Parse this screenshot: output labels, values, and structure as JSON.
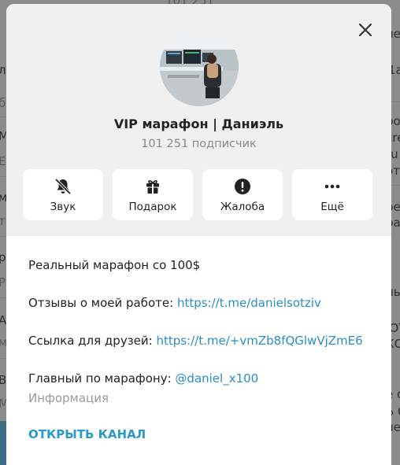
{
  "background": {
    "left_fragments": [
      "л",
      "б",
      "М",
      "Е",
      "м",
      "т",
      "р",
      "Р",
      "А",
      "м",
      "В",
      "М"
    ],
    "right_fragments": [
      "ле",
      "1а",
      "ро д",
      "cre",
      "ru",
      "от",
      "ре",
      "ра -",
      "ны",
      "ЮТ",
      "КО",
      "е о",
      "Ь О",
      "ле"
    ],
    "top_fragment": "101 251"
  },
  "dialog": {
    "channel_name": "VIP марафон | Даниэль",
    "subscribers": "101 251 подписчик",
    "actions": [
      {
        "label": "Звук",
        "icon": "bell-off-icon"
      },
      {
        "label": "Подарок",
        "icon": "gift-icon"
      },
      {
        "label": "Жалоба",
        "icon": "report-icon"
      },
      {
        "label": "Ещё",
        "icon": "more-icon"
      }
    ],
    "description": {
      "line1": "Реальный марафон со 100$",
      "reviews_label": "Отзывы о моей работе: ",
      "reviews_link": "https://t.me/danielsotziv",
      "friends_label": "Ссылка для друзей: ",
      "friends_link": "https://t.me/+vmZb8fQGlwVjZmE6",
      "main_label": "Главный по марафону: ",
      "main_link": "@daniel_x100"
    },
    "info_caption": "Информация",
    "open_channel": "ОТКРЫТЬ КАНАЛ"
  },
  "colors": {
    "accent": "#2b9ac9",
    "link": "#2b8ec4",
    "panel_bg": "#f0f0f0",
    "overlay": "#8c8c8c"
  }
}
